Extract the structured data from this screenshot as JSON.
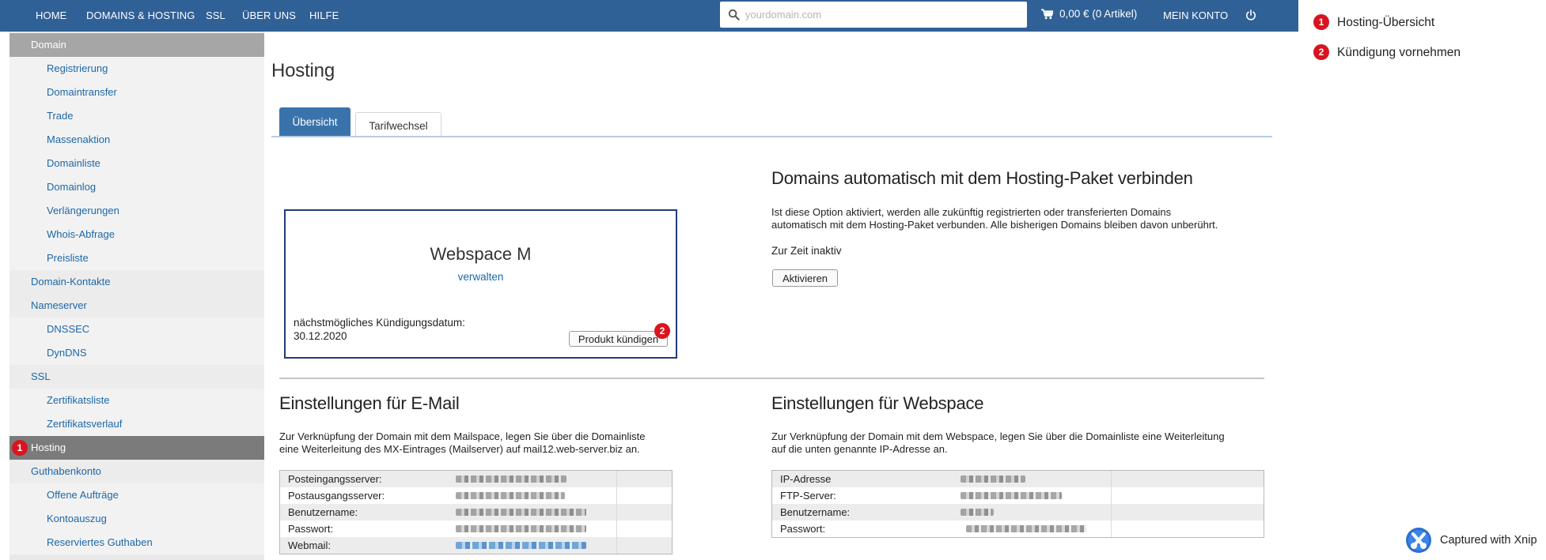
{
  "nav": {
    "items": [
      "HOME",
      "DOMAINS & HOSTING",
      "SSL",
      "ÜBER UNS",
      "HILFE"
    ],
    "search_placeholder": "yourdomain.com",
    "cart_label": "0,00 € (0 Artikel)",
    "account_label": "MEIN KONTO"
  },
  "sidebar": {
    "items": [
      {
        "label": "Domain",
        "level": 1,
        "state": "head"
      },
      {
        "label": "Registrierung",
        "level": 2
      },
      {
        "label": "Domaintransfer",
        "level": 2
      },
      {
        "label": "Trade",
        "level": 2
      },
      {
        "label": "Massenaktion",
        "level": 2
      },
      {
        "label": "Domainliste",
        "level": 2
      },
      {
        "label": "Domainlog",
        "level": 2
      },
      {
        "label": "Verlängerungen",
        "level": 2
      },
      {
        "label": "Whois-Abfrage",
        "level": 2
      },
      {
        "label": "Preisliste",
        "level": 2
      },
      {
        "label": "Domain-Kontakte",
        "level": 1
      },
      {
        "label": "Nameserver",
        "level": 1
      },
      {
        "label": "DNSSEC",
        "level": 2
      },
      {
        "label": "DynDNS",
        "level": 2
      },
      {
        "label": "SSL",
        "level": 1
      },
      {
        "label": "Zertifikatsliste",
        "level": 2
      },
      {
        "label": "Zertifikatsverlauf",
        "level": 2
      },
      {
        "label": "Hosting",
        "level": 1,
        "state": "active",
        "badge": "1"
      },
      {
        "label": "Guthabenkonto",
        "level": 1
      },
      {
        "label": "Offene Aufträge",
        "level": 2
      },
      {
        "label": "Kontoauszug",
        "level": 2
      },
      {
        "label": "Reserviertes Guthaben",
        "level": 2
      }
    ]
  },
  "main": {
    "title": "Hosting",
    "tabs": [
      {
        "label": "Übersicht",
        "active": true
      },
      {
        "label": "Tarifwechsel",
        "active": false
      }
    ],
    "product": {
      "name": "Webspace M",
      "manage_label": "verwalten",
      "date_label": "nächstmögliches Kündigungsdatum:",
      "date": "30.12.2020",
      "cancel_button": "Produkt kündigen",
      "badge": "2"
    },
    "auto_connect": {
      "title": "Domains automatisch mit dem Hosting-Paket verbinden",
      "text_line1": "Ist diese Option aktiviert, werden alle zukünftig registrierten oder transferierten Domains",
      "text_line2": "automatisch mit dem Hosting-Paket verbunden. Alle bisherigen Domains bleiben davon unberührt.",
      "status": "Zur Zeit inaktiv",
      "button": "Aktivieren"
    },
    "email_settings": {
      "title": "Einstellungen für E-Mail",
      "text_line1": "Zur Verknüpfung der Domain mit dem Mailspace, legen Sie über die Domainliste",
      "text_line2": "eine Weiterleitung des MX-Eintrages (Mailserver) auf mail12.web-server.biz an.",
      "rows": [
        "Posteingangsserver:",
        "Postausgangsserver:",
        "Benutzername:",
        "Passwort:",
        "Webmail:"
      ]
    },
    "webspace_settings": {
      "title": "Einstellungen für Webspace",
      "text_line1": "Zur Verknüpfung der Domain mit dem Webspace, legen Sie über die Domainliste eine Weiterleitung",
      "text_line2": "auf die unten genannte IP-Adresse an.",
      "rows": [
        "IP-Adresse",
        "FTP-Server:",
        "Benutzername:",
        "Passwort:"
      ]
    }
  },
  "legend": [
    {
      "number": "1",
      "label": "Hosting-Übersicht"
    },
    {
      "number": "2",
      "label": "Kündigung vornehmen"
    }
  ],
  "watermark": "Captured with Xnip",
  "colors": {
    "nav_bg": "#2f6096",
    "link": "#1d67a8",
    "tab_active": "#3a73ac",
    "badge": "#d9141f",
    "sidebar_active": "#7b7b7b"
  }
}
